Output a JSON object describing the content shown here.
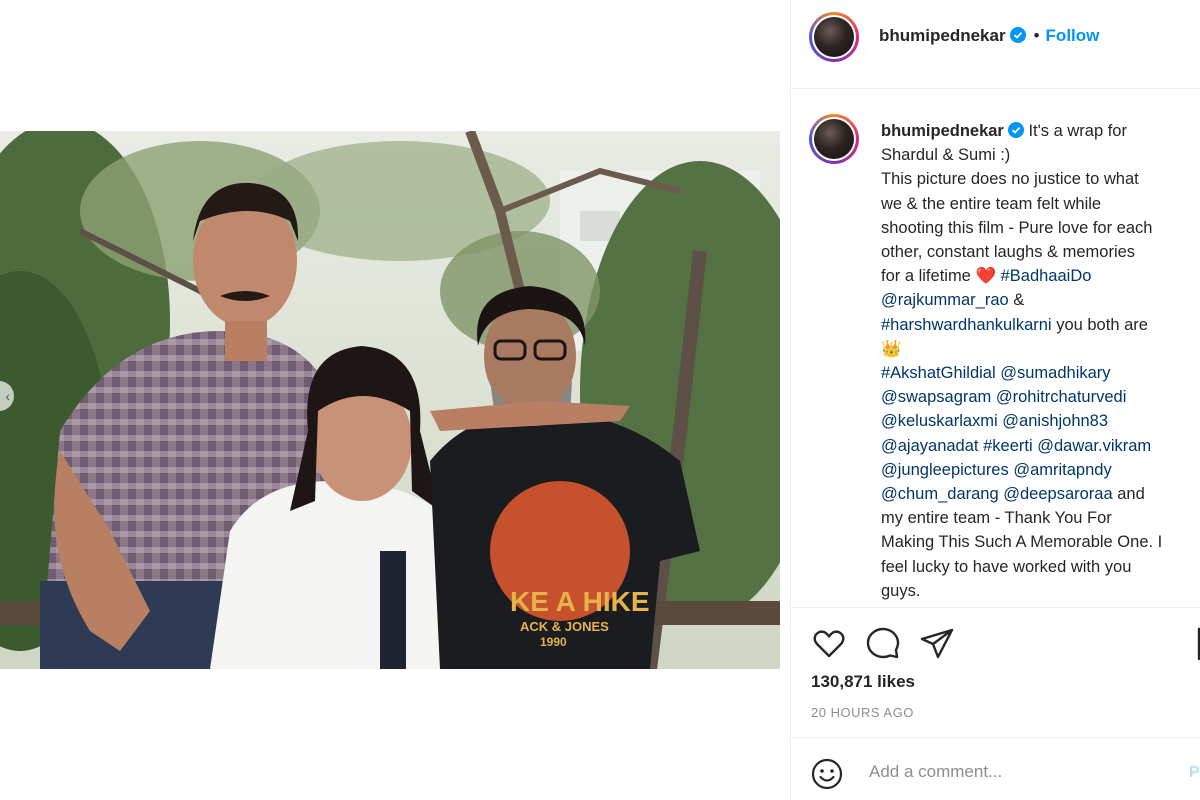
{
  "post": {
    "media_alt": "Three people posing outdoors in front of trees",
    "prev_glyph": "‹"
  },
  "header": {
    "username": "bhumipednekar",
    "dot": "•",
    "follow_label": "Follow"
  },
  "caption": {
    "username": "bhumipednekar",
    "lines": [
      " It's a wrap for\nShardul & Sumi :)\nThis picture does no justice to what\nwe & the entire team felt while\nshooting this film - Pure love for each\nother, constant laughs & memories\nfor a lifetime ",
      "❤️",
      " "
    ],
    "hashtag_badhaaido": "#BadhaaiDo",
    "newline1": "\n",
    "mention_rajkummar": "@rajkummar_rao",
    "amp": " &\n",
    "hashtag_harsh": "#harshwardhankulkarni",
    "you_both_are": " you both are\n",
    "crown": "👑",
    "newline2": "\n",
    "tags": [
      "#AkshatGhildial",
      " ",
      "@sumadhikary",
      "\n",
      "@swapsagram",
      " ",
      "@rohitrchaturvedi",
      "\n",
      "@keluskarlaxmi",
      " ",
      "@anishjohn83",
      "\n",
      "@ajayanadat",
      " ",
      "#keerti",
      " ",
      "@dawar.vikram",
      "\n",
      "@jungleepictures",
      " ",
      "@amritapndy",
      "\n",
      "@chum_darang",
      " ",
      "@deepsaroraa"
    ],
    "closing": " and\nmy entire team - Thank You For\nMaking This Such A Memorable One. I\nfeel lucky to have worked with you\nguys."
  },
  "actions": {
    "like_icon": "heart-icon",
    "comment_icon": "comment-icon",
    "share_icon": "share-icon",
    "save_icon": "bookmark-icon",
    "likes": "130,871 likes",
    "time": "20 HOURS AGO"
  },
  "comment": {
    "placeholder": "Add a comment...",
    "post_label": "Post"
  },
  "colors": {
    "accent": "#0095f6",
    "link": "#00376b",
    "muted": "#8e8e8e",
    "divider": "#efefef"
  }
}
